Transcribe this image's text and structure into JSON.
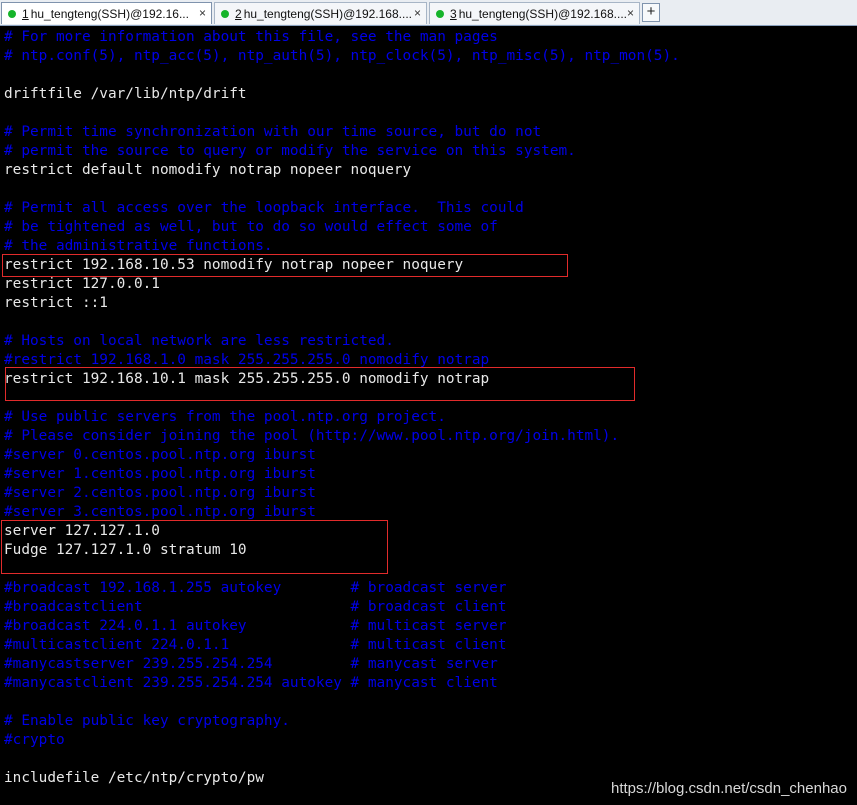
{
  "tabs": [
    {
      "num": "1",
      "title": " hu_tengteng(SSH)@192.16...",
      "active": true,
      "close": "×"
    },
    {
      "num": "2",
      "title": " hu_tengteng(SSH)@192.168....",
      "active": false,
      "close": "×"
    },
    {
      "num": "3",
      "title": " hu_tengteng(SSH)@192.168....",
      "active": false,
      "close": "×"
    }
  ],
  "new_tab": "+",
  "lines": [
    {
      "text": "# For more information about this file, see the man pages",
      "kind": "comment"
    },
    {
      "text": "# ntp.conf(5), ntp_acc(5), ntp_auth(5), ntp_clock(5), ntp_misc(5), ntp_mon(5).",
      "kind": "comment"
    },
    {
      "text": "",
      "kind": "text"
    },
    {
      "text": "driftfile /var/lib/ntp/drift",
      "kind": "text"
    },
    {
      "text": "",
      "kind": "text"
    },
    {
      "text": "# Permit time synchronization with our time source, but do not",
      "kind": "comment"
    },
    {
      "text": "# permit the source to query or modify the service on this system.",
      "kind": "comment"
    },
    {
      "text": "restrict default nomodify notrap nopeer noquery",
      "kind": "text"
    },
    {
      "text": "",
      "kind": "text"
    },
    {
      "text": "# Permit all access over the loopback interface.  This could",
      "kind": "comment"
    },
    {
      "text": "# be tightened as well, but to do so would effect some of",
      "kind": "comment"
    },
    {
      "text": "# the administrative functions.",
      "kind": "comment"
    },
    {
      "text": "restrict 192.168.10.53 nomodify notrap nopeer noquery",
      "kind": "text"
    },
    {
      "text": "restrict 127.0.0.1",
      "kind": "text"
    },
    {
      "text": "restrict ::1",
      "kind": "text"
    },
    {
      "text": "",
      "kind": "text"
    },
    {
      "text": "# Hosts on local network are less restricted.",
      "kind": "comment"
    },
    {
      "text": "#restrict 192.168.1.0 mask 255.255.255.0 nomodify notrap",
      "kind": "comment"
    },
    {
      "text": "restrict 192.168.10.1 mask 255.255.255.0 nomodify notrap",
      "kind": "text"
    },
    {
      "text": "",
      "kind": "text"
    },
    {
      "text": "# Use public servers from the pool.ntp.org project.",
      "kind": "comment"
    },
    {
      "text": "# Please consider joining the pool (http://www.pool.ntp.org/join.html).",
      "kind": "comment"
    },
    {
      "text": "#server 0.centos.pool.ntp.org iburst",
      "kind": "comment"
    },
    {
      "text": "#server 1.centos.pool.ntp.org iburst",
      "kind": "comment"
    },
    {
      "text": "#server 2.centos.pool.ntp.org iburst",
      "kind": "comment"
    },
    {
      "text": "#server 3.centos.pool.ntp.org iburst",
      "kind": "comment"
    },
    {
      "text": "server 127.127.1.0",
      "kind": "text"
    },
    {
      "text": "Fudge 127.127.1.0 stratum 10",
      "kind": "text"
    },
    {
      "text": "",
      "kind": "text"
    },
    {
      "text": "#broadcast 192.168.1.255 autokey        # broadcast server",
      "kind": "comment"
    },
    {
      "text": "#broadcastclient                        # broadcast client",
      "kind": "comment"
    },
    {
      "text": "#broadcast 224.0.1.1 autokey            # multicast server",
      "kind": "comment"
    },
    {
      "text": "#multicastclient 224.0.1.1              # multicast client",
      "kind": "comment"
    },
    {
      "text": "#manycastserver 239.255.254.254         # manycast server",
      "kind": "comment"
    },
    {
      "text": "#manycastclient 239.255.254.254 autokey # manycast client",
      "kind": "comment"
    },
    {
      "text": "",
      "kind": "text"
    },
    {
      "text": "# Enable public key cryptography.",
      "kind": "comment"
    },
    {
      "text": "#crypto",
      "kind": "comment"
    },
    {
      "text": "",
      "kind": "text"
    },
    {
      "text": "includefile /etc/ntp/crypto/pw",
      "kind": "text"
    }
  ],
  "colors": {
    "comment": "#0000e8",
    "text": "#e8e8e8",
    "highlight_box": "#e12b2b",
    "background": "#000000"
  },
  "watermark": "https://blog.csdn.net/csdn_chenhao"
}
